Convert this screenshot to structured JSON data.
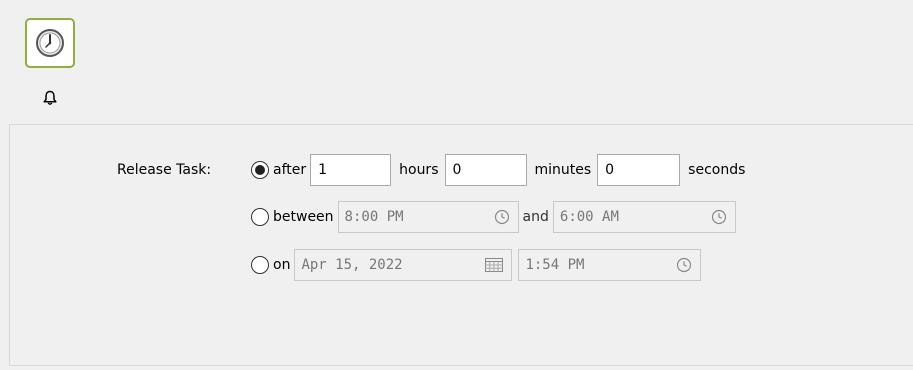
{
  "tabs": [
    {
      "icon": "clock-icon",
      "selected": true
    },
    {
      "icon": "bell-icon",
      "selected": false
    }
  ],
  "release": {
    "label": "Release Task:",
    "options": [
      {
        "label": "after",
        "selected": true,
        "hours_value": "1",
        "hours_label": "hours",
        "minutes_value": "0",
        "minutes_label": "minutes",
        "seconds_value": "0",
        "seconds_label": "seconds"
      },
      {
        "label": "between",
        "selected": false,
        "start_time": "8:00 PM",
        "and_label": "and",
        "end_time": "6:00 AM"
      },
      {
        "label": "on",
        "selected": false,
        "date": "Apr 15, 2022",
        "time": "1:54 PM"
      }
    ]
  },
  "colors": {
    "selected_tab_border": "#8fae3f",
    "panel_bg": "#f0f0f0"
  }
}
